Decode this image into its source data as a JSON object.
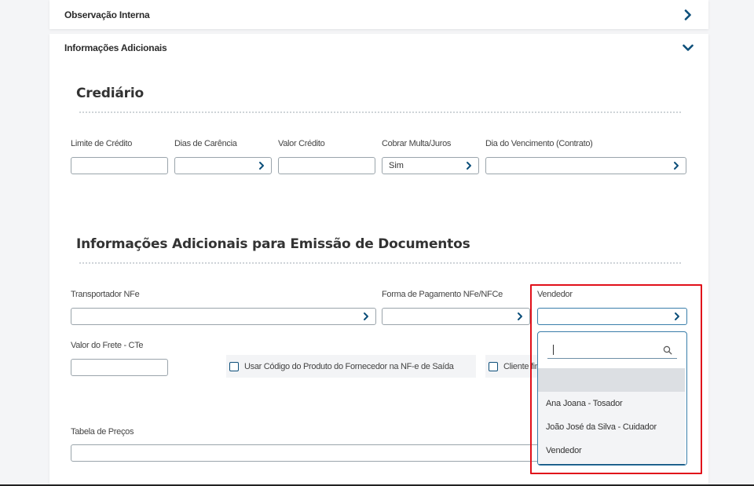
{
  "panels": {
    "obs_interna": "Observação Interna",
    "info_adicionais": "Informações Adicionais"
  },
  "crediario": {
    "title": "Crediário",
    "limite_label": "Limite de Crédito",
    "dias_label": "Dias de Carência",
    "valor_label": "Valor Crédito",
    "multa_label": "Cobrar Multa/Juros",
    "multa_value": "Sim",
    "vencimento_label": "Dia do Vencimento (Contrato)"
  },
  "emissao": {
    "title": "Informações Adicionais para Emissão de Documentos",
    "transportador_label": "Transportador NFe",
    "pagamento_label": "Forma de Pagamento NFe/NFCe",
    "vendedor_label": "Vendedor",
    "frete_label": "Valor do Frete - CTe",
    "usar_codigo_label": "Usar Código do Produto do Fornecedor na NF-e de Saída",
    "cliente_label": "Cliente fin",
    "tabela_label": "Tabela de Preços"
  },
  "dropdown": {
    "search_value": "",
    "options": [
      "",
      "Ana Joana - Tosador",
      "João José da Silva - Cuidador",
      "Vendedor"
    ]
  },
  "colors": {
    "accent": "#0d4f7a",
    "highlight": "#e1101a"
  },
  "icons": {
    "chevron_right": "chevron-right-icon",
    "chevron_down": "chevron-down-icon",
    "search": "search-icon"
  }
}
